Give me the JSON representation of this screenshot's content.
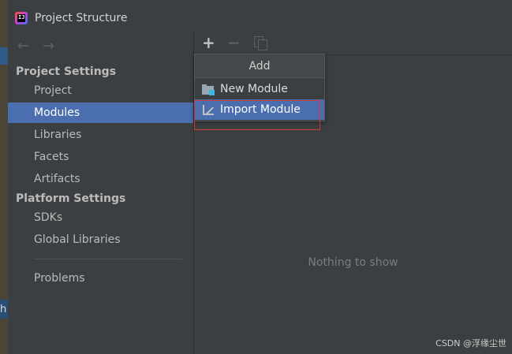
{
  "window": {
    "title": "Project Structure"
  },
  "nav": {
    "back": "←",
    "forward": "→"
  },
  "sidebar": {
    "sections": [
      {
        "heading": "Project Settings",
        "items": [
          "Project",
          "Modules",
          "Libraries",
          "Facets",
          "Artifacts"
        ]
      },
      {
        "heading": "Platform Settings",
        "items": [
          "SDKs",
          "Global Libraries"
        ]
      }
    ],
    "extra_item": "Problems",
    "selected": "Modules"
  },
  "toolbar": {
    "add": "+",
    "remove": "−"
  },
  "popup": {
    "header": "Add",
    "items": [
      {
        "label": "New Module",
        "icon": "folder-module-icon"
      },
      {
        "label": "Import Module",
        "icon": "import-icon"
      }
    ],
    "selected": "Import Module"
  },
  "main": {
    "empty_text": "Nothing to show"
  },
  "watermark": "CSDN @浮缘尘世",
  "background_fragment": "h",
  "colors": {
    "selection": "#4b6eaf",
    "highlight_border": "#d23a3a",
    "background": "#3c3f41"
  }
}
